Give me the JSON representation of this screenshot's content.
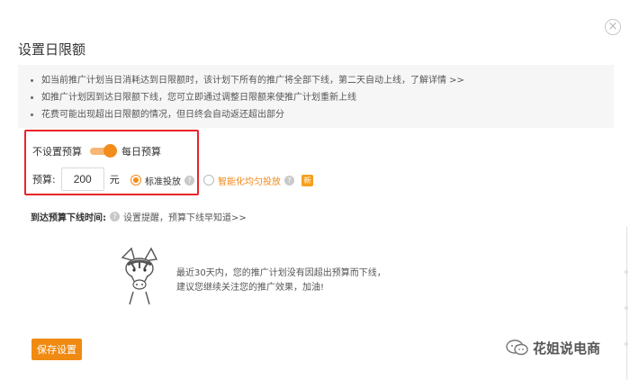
{
  "dialog": {
    "title": "设置日限额",
    "close_glyph": "×"
  },
  "notice": {
    "items": [
      "如当前推广计划当日消耗达到日限额时，该计划下所有的推广将全部下线，第二天自动上线，了解详情 >>",
      "如推广计划因到达日限额下线，您可立即通过调整日限额来使推广计划重新上线",
      "花费可能出现超出日限额的情况，但日终会自动返还超出部分"
    ]
  },
  "budget_mode": {
    "off_label": "不设置预算",
    "on_label": "每日预算",
    "toggle_on": true,
    "accent_color": "#f28c1a"
  },
  "budget": {
    "label": "预算:",
    "value": "200",
    "unit": "元"
  },
  "delivery": {
    "standard_label": "标准投放",
    "smart_label": "智能化均匀投放",
    "selected": "standard",
    "new_badge": "新",
    "help_glyph": "?"
  },
  "offline_time": {
    "label": "到达预算下线时间:",
    "link_text": "设置提醒，预算下线早知道>>"
  },
  "empty_state": {
    "line1": "最近30天内，您的推广计划没有因超出预算而下线，",
    "line2": "建议您继续关注您的推广效果，加油!",
    "mascot_icon": "zebra-mascot-icon"
  },
  "footer": {
    "save_label": "保存设置"
  },
  "watermark": {
    "text": "花姐说电商",
    "icon": "wechat-icon"
  }
}
